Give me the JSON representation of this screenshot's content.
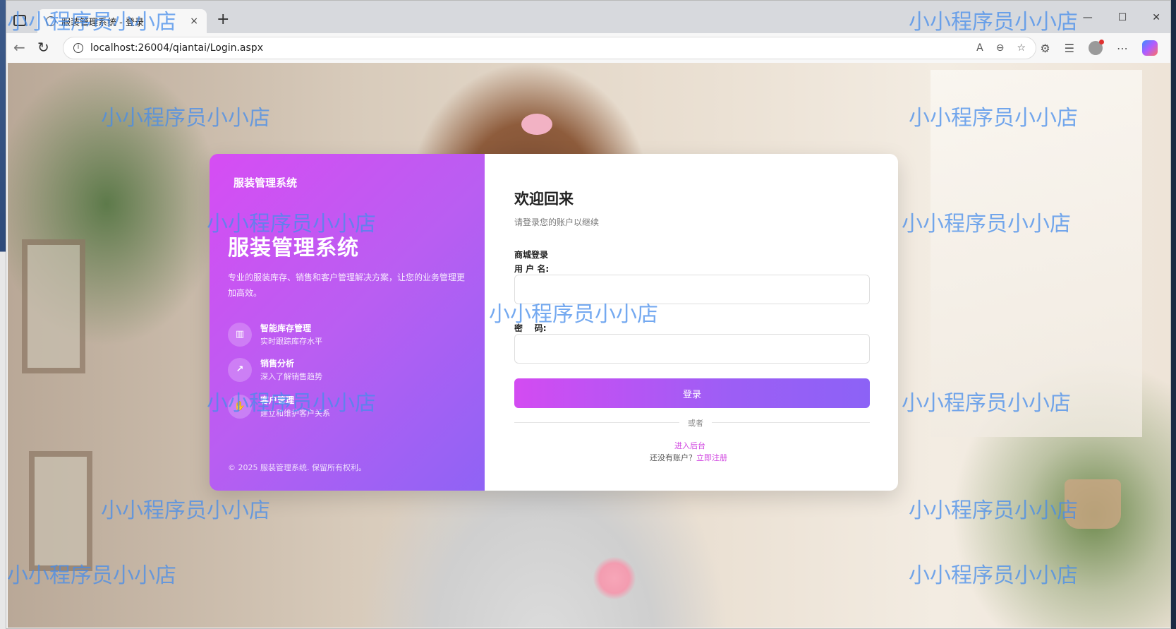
{
  "browser": {
    "tab_title": "服装管理系统 - 登录",
    "tab_close": "×",
    "new_tab": "+",
    "url": "localhost:26004/qiantai/Login.aspx",
    "win_minimize": "—",
    "win_maximize": "☐",
    "win_close": "✕"
  },
  "card_left": {
    "brand": "服装管理系统",
    "hero_title": "服装管理系统",
    "hero_desc": "专业的服装库存、销售和客户管理解决方案，让您的业务管理更加高效。",
    "features": [
      {
        "icon": "barcode-icon",
        "glyph": "▥",
        "title": "智能库存管理",
        "subtitle": "实时跟踪库存水平"
      },
      {
        "icon": "chart-icon",
        "glyph": "↗",
        "title": "销售分析",
        "subtitle": "深入了解销售趋势"
      },
      {
        "icon": "handshake-icon",
        "glyph": "✋",
        "title": "客户管理",
        "subtitle": "建立和维护客户关系"
      }
    ],
    "copyright": "© 2025 服装管理系统. 保留所有权利。"
  },
  "card_right": {
    "welcome": "欢迎回来",
    "welcome_sub": "请登录您的账户以继续",
    "mall_label": "商城登录",
    "username_label": "用 户 名:",
    "username_value": "",
    "password_label": "密    码:",
    "password_value": "",
    "login_button": "登录",
    "divider_text": "或者",
    "admin_link": "进入后台",
    "register_prompt": "还没有账户？",
    "register_link": "立即注册"
  },
  "watermark": "小小程序员小小店",
  "colors": {
    "accent_start": "#d64df3",
    "accent_end": "#8f63f5",
    "link": "#d043e0"
  }
}
